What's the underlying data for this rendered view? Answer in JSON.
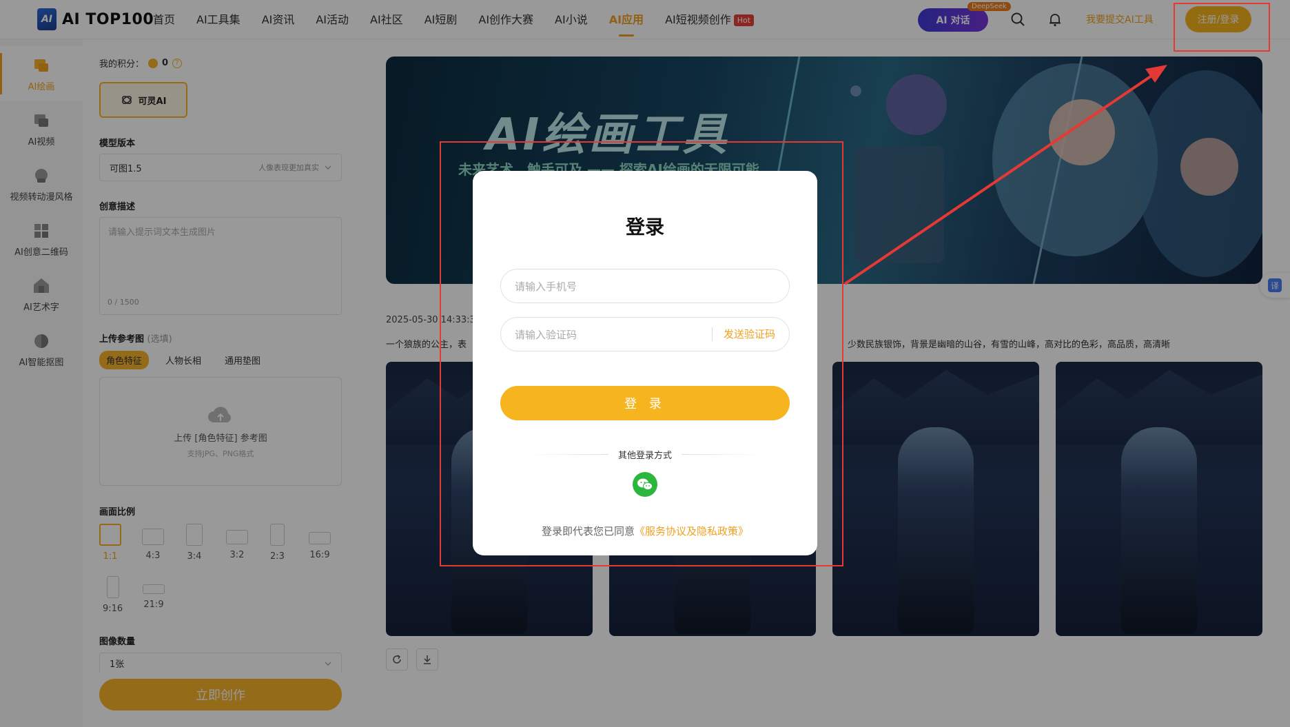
{
  "nav": {
    "logo_mark": "AI",
    "logo_text": "AI TOP100",
    "links": [
      "首页",
      "AI工具集",
      "AI资讯",
      "AI活动",
      "AI社区",
      "AI短剧",
      "AI创作大赛",
      "AI小说",
      "AI应用",
      "AI短视频创作"
    ],
    "active_index": 8,
    "hot_badge": "Hot",
    "ai_chat": "AI 对话",
    "deepseek_badge": "DeepSeek",
    "submit_tool": "我要提交AI工具",
    "login_register": "注册/登录"
  },
  "rail": {
    "items": [
      "AI绘画",
      "AI视频",
      "视频转动漫风格",
      "AI创意二维码",
      "AI艺术字",
      "AI智能抠图"
    ],
    "active_index": 0
  },
  "panel": {
    "credits_label": "我的积分：",
    "credits_value": "0",
    "help_icon": "?",
    "model_chip": "可灵AI",
    "model_version_title": "模型版本",
    "model_version_value": "可图1.5",
    "model_version_hint": "人像表现更加真实",
    "prompt_title": "创意描述",
    "prompt_placeholder": "请输入提示词文本生成图片",
    "prompt_counter": "0 / 1500",
    "upload_title": "上传参考图",
    "upload_optional": "(选填)",
    "upload_tabs": [
      "角色特征",
      "人物长相",
      "通用垫图"
    ],
    "upload_text": "上传 [角色特征] 参考图",
    "upload_formats": "支持JPG、PNG格式",
    "ratio_title": "画面比例",
    "ratios": [
      "1:1",
      "4:3",
      "3:4",
      "3:2",
      "2:3",
      "16:9",
      "9:16",
      "21:9"
    ],
    "count_title": "图像数量",
    "count_value": "1张",
    "create_button": "立即创作"
  },
  "main": {
    "banner_title": "AI绘画工具",
    "banner_subtitle": "未来艺术，触手可及 —— 探索AI绘画的无限可能",
    "date": "2025-05-30 14:33:33",
    "desc_left": "一个狼族的公主，表",
    "desc_right": "少数民族银饰，背景是幽暗的山谷，有雪的山峰，高对比的色彩，高品质，高清晰",
    "translate_label": "译"
  },
  "modal": {
    "title": "登录",
    "phone_placeholder": "请输入手机号",
    "code_placeholder": "请输入验证码",
    "send_code": "发送验证码",
    "submit": "登 录",
    "other_methods": "其他登录方式",
    "agree_prefix": "登录即代表您已同意",
    "agree_link": "《服务协议及隐私政策》"
  },
  "colors": {
    "accent": "#f6b41f",
    "annotation_red": "#e53935",
    "wechat_green": "#2db63e"
  }
}
